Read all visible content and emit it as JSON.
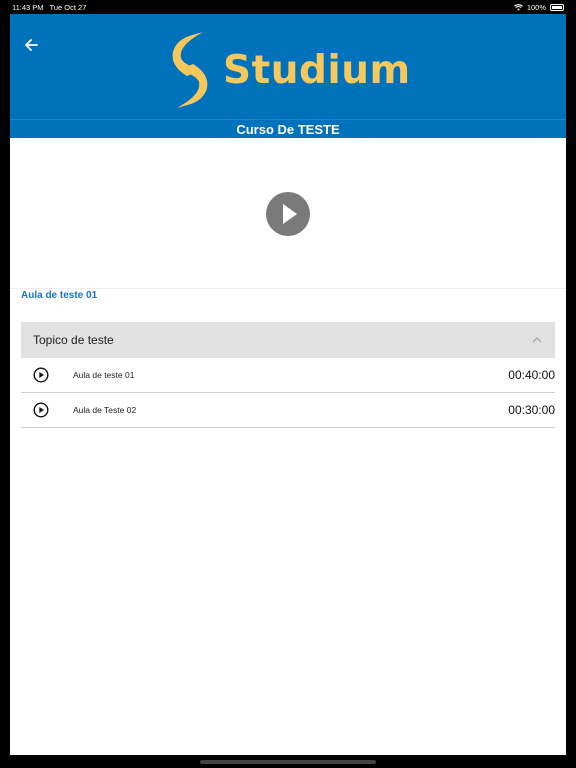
{
  "status_bar": {
    "time": "11:43 PM",
    "date": "Tue Oct 27",
    "battery": "100%"
  },
  "header": {
    "logo_text": "Studium",
    "course_title": "Curso De TESTE"
  },
  "current_lesson": "Aula de teste 01",
  "topic": {
    "title": "Topico de teste",
    "lessons": [
      {
        "title": "Aula de teste 01",
        "duration": "00:40:00"
      },
      {
        "title": "Aula de Teste 02",
        "duration": "00:30:00"
      }
    ]
  },
  "colors": {
    "header_bg": "#0072bc",
    "logo": "#f6c75b",
    "link": "#1a73c7"
  }
}
